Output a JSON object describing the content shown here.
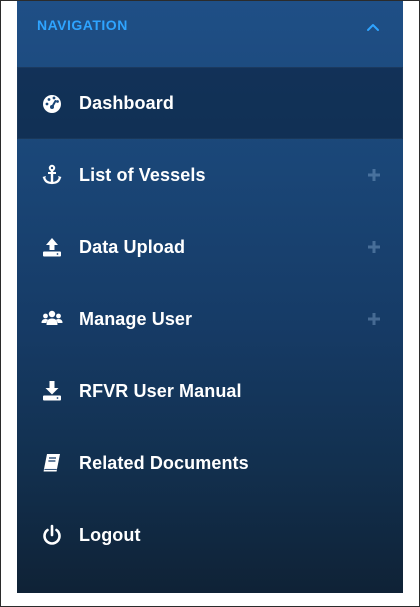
{
  "nav": {
    "title": "NAVIGATION",
    "collapse_icon": "chevron-up-icon"
  },
  "menu": {
    "items": [
      {
        "label": "Dashboard",
        "icon": "dashboard-gauge-icon",
        "expandable": false,
        "active": true
      },
      {
        "label": "List of Vessels",
        "icon": "anchor-icon",
        "expandable": true,
        "active": false
      },
      {
        "label": "Data Upload",
        "icon": "upload-icon",
        "expandable": true,
        "active": false
      },
      {
        "label": "Manage User",
        "icon": "users-icon",
        "expandable": true,
        "active": false
      },
      {
        "label": "RFVR User Manual",
        "icon": "download-icon",
        "expandable": false,
        "active": false
      },
      {
        "label": "Related Documents",
        "icon": "book-icon",
        "expandable": false,
        "active": false
      },
      {
        "label": "Logout",
        "icon": "power-icon",
        "expandable": false,
        "active": false
      }
    ]
  },
  "colors": {
    "accent": "#2ea4ff",
    "text": "#ffffff",
    "sidebar_top": "#1f4f86",
    "sidebar_bottom": "#0f2236"
  }
}
